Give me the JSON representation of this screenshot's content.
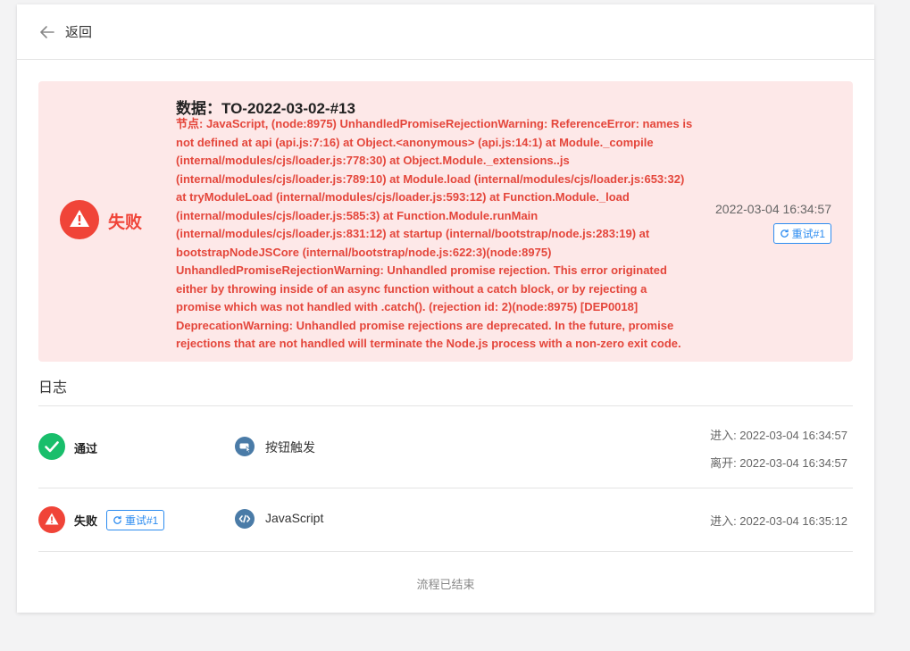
{
  "header": {
    "back_label": "返回"
  },
  "alert": {
    "status": "失败",
    "title": "数据：TO-2022-03-02-#13",
    "message_lines": [
      "节点: JavaScript, (node:8975) UnhandledPromiseRejectionWarning: ReferenceError: names is",
      "not defined at api (api.js:7:16) at Object.<anonymous> (api.js:14:1) at Module._compile",
      "(internal/modules/cjs/loader.js:778:30) at Object.Module._extensions..js",
      "(internal/modules/cjs/loader.js:789:10) at Module.load (internal/modules/cjs/loader.js:653:32)",
      "at tryModuleLoad (internal/modules/cjs/loader.js:593:12) at Function.Module._load",
      "(internal/modules/cjs/loader.js:585:3) at Function.Module.runMain",
      "(internal/modules/cjs/loader.js:831:12) at startup (internal/bootstrap/node.js:283:19) at",
      "bootstrapNodeJSCore (internal/bootstrap/node.js:622:3)(node:8975)",
      "UnhandledPromiseRejectionWarning: Unhandled promise rejection. This error originated",
      "either by throwing inside of an async function without a catch block, or by rejecting a",
      "promise which was not handled with .catch(). (rejection id: 2)(node:8975) [DEP0018]",
      "DeprecationWarning: Unhandled promise rejections are deprecated. In the future, promise",
      "rejections that are not handled will terminate the Node.js process with a non-zero exit code."
    ],
    "time": "2022-03-04 16:34:57",
    "retry_label": "重试#1"
  },
  "log": {
    "title": "日志",
    "rows": [
      {
        "status": "通过",
        "node": "按钮触发",
        "enter": "进入: 2022-03-04 16:34:57",
        "leave": "离开: 2022-03-04 16:34:57"
      },
      {
        "status": "失败",
        "retry_label": "重试#1",
        "node": "JavaScript",
        "enter": "进入: 2022-03-04 16:35:12"
      }
    ],
    "footer": "流程已结束"
  },
  "colors": {
    "error": "#f04438",
    "success": "#19be6b",
    "link": "#2d8cf0",
    "node_icon": "#4a7ba7",
    "alert_bg": "#fde8e8"
  },
  "icons": {
    "back": "arrow-left-icon",
    "error": "warning-triangle-icon",
    "success": "check-icon",
    "retry": "refresh-icon",
    "button_node": "button-trigger-icon",
    "code_node": "code-icon"
  }
}
